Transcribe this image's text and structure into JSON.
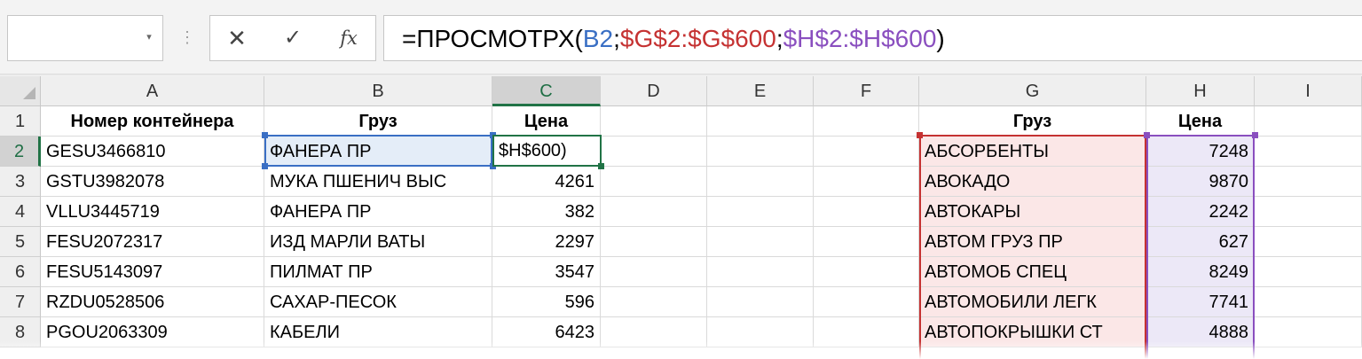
{
  "formula_bar": {
    "name_box": "",
    "cancel_glyph": "✕",
    "enter_glyph": "✓",
    "fx_glyph": "fx",
    "formula": {
      "prefix": "=ПРОСМОТРХ(",
      "arg1": "B2",
      "sep1": ";",
      "arg2": "$G$2:$G$600",
      "sep2": ";",
      "arg3": "$H$2:$H$600",
      "suffix": ")"
    }
  },
  "columns": [
    "A",
    "B",
    "C",
    "D",
    "E",
    "F",
    "G",
    "H",
    "I"
  ],
  "selected_column": "C",
  "selected_row": "2",
  "rows": [
    {
      "num": "1",
      "a": "Номер контейнера",
      "b": "Груз",
      "c": "Цена",
      "g": "Груз",
      "h": "Цена"
    },
    {
      "num": "2",
      "a": "GESU3466810",
      "b": "ФАНЕРА ПР",
      "c": "$H$600)",
      "g": "АБСОРБЕНТЫ",
      "h": "7248"
    },
    {
      "num": "3",
      "a": "GSTU3982078",
      "b": "МУКА ПШЕНИЧ ВЫС",
      "c": "4261",
      "g": "АВОКАДО",
      "h": "9870"
    },
    {
      "num": "4",
      "a": "VLLU3445719",
      "b": "ФАНЕРА ПР",
      "c": "382",
      "g": "АВТОКАРЫ",
      "h": "2242"
    },
    {
      "num": "5",
      "a": "FESU2072317",
      "b": "ИЗД МАРЛИ ВАТЫ",
      "c": "2297",
      "g": "АВТОМ ГРУЗ ПР",
      "h": "627"
    },
    {
      "num": "6",
      "a": "FESU5143097",
      "b": "ПИЛМАТ ПР",
      "c": "3547",
      "g": "АВТОМОБ СПЕЦ",
      "h": "8249"
    },
    {
      "num": "7",
      "a": "RZDU0528506",
      "b": "САХАР-ПЕСОК",
      "c": "596",
      "g": "АВТОМОБИЛИ ЛЕГК",
      "h": "7741"
    },
    {
      "num": "8",
      "a": "PGOU2063309",
      "b": "КАБЕЛИ",
      "c": "6423",
      "g": "АВТОПОКРЫШКИ СТ",
      "h": "4888"
    }
  ],
  "colors": {
    "range_b2": "#3a6fc4",
    "range_g": "#c53232",
    "range_h": "#8a4fbf",
    "active_cell": "#217346"
  }
}
